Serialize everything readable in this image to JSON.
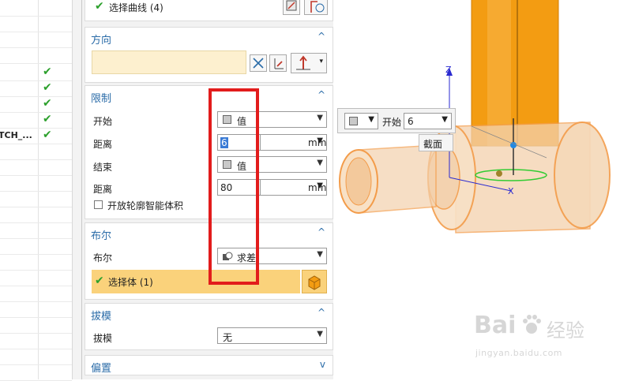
{
  "navigator": {
    "truncated_item": "TCH_...",
    "check_glyph": "✔",
    "checked_rows": 5
  },
  "dialog": {
    "select_curve": {
      "check": "✔",
      "label": "选择曲线 (4)"
    },
    "direction": {
      "title": "方向",
      "caret": "^",
      "value": ""
    },
    "limits": {
      "title": "限制",
      "caret": "^",
      "start_label": "开始",
      "start_value": "值",
      "distance1_label": "距离",
      "distance1_value": "6",
      "distance1_unit": "mm",
      "end_label": "结束",
      "end_value": "值",
      "distance2_label": "距离",
      "distance2_value": "80",
      "distance2_unit": "mm",
      "open_profile_label": "开放轮廓智能体积"
    },
    "boolean": {
      "title": "布尔",
      "caret": "^",
      "bool_label": "布尔",
      "bool_value": "求差",
      "select_body_check": "✔",
      "select_body_label": "选择体 (1)"
    },
    "draft": {
      "title": "拔模",
      "caret": "^",
      "draft_label": "拔模",
      "draft_value": "无"
    },
    "offset": {
      "title": "偏置",
      "caret": "v"
    }
  },
  "viewport_popup": {
    "start_label": "开始",
    "start_value": "6",
    "section_label": "截面"
  },
  "axis": {
    "z": "Z",
    "x": "X"
  },
  "watermark": {
    "brand": "Bai",
    "brand2": "经验",
    "url": "jingyan.baidu.com"
  },
  "colors": {
    "accent_blue": "#2b6ca8",
    "highlight_red": "#e21c1c",
    "selection_yellow": "#fad27b",
    "pipe_orange": "#f39c12",
    "pipe_translucent": "#f3d1ad"
  }
}
